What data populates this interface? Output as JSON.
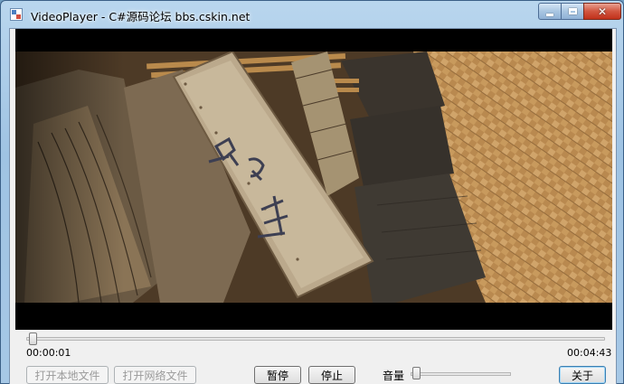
{
  "window": {
    "title": "VideoPlayer - C#源码论坛 bbs.cskin.net",
    "min_icon": "minimize-icon",
    "max_icon": "maximize-icon",
    "close_icon": "close-icon",
    "close_glyph": "✕"
  },
  "player": {
    "frame_description_icon": "video-frame",
    "progress_fraction": 0.004,
    "current_time": "00:00:01",
    "total_time": "00:04:43"
  },
  "buttons": {
    "open_local": "打开本地文件",
    "open_network": "打开网络文件",
    "pause": "暂停",
    "stop": "停止",
    "about": "关于"
  },
  "volume": {
    "label": "音量",
    "level_fraction": 0.02
  },
  "colors": {
    "titlebar": "#a6c8e6",
    "close_button": "#c1321c",
    "video_background": "#000000"
  }
}
